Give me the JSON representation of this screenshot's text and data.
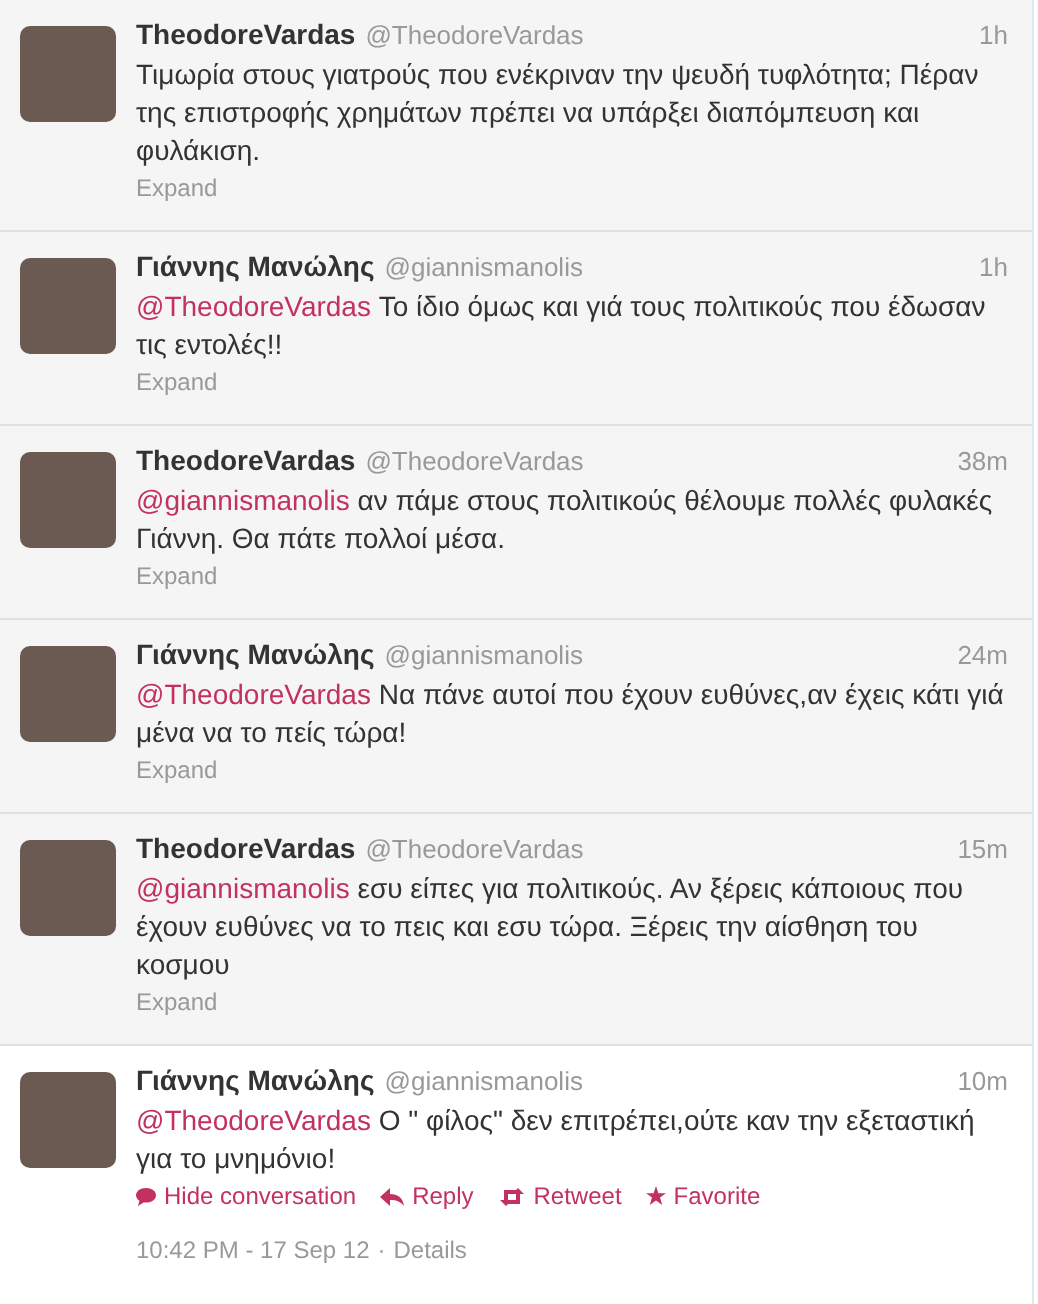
{
  "tweets": [
    {
      "name": "TheodoreVardas",
      "handle": "@TheodoreVardas",
      "time": "1h",
      "text": "Τιμωρία στους γιατρούς που ενέκριναν την ψευδή τυφλότητα; Πέραν της επιστροφής χρημάτων πρέπει να υπάρξει διαπόμπευση και φυλάκιση.",
      "expand": "Expand",
      "selected": false
    },
    {
      "name": "Γιάννης Μανώλης",
      "handle": "@giannismanolis",
      "time": "1h",
      "mention": "@TheodoreVardas",
      "text": "Το ίδιο όμως και γιά τους πολιτικούς που έδωσαν τις εντολές!!",
      "expand": "Expand",
      "selected": false
    },
    {
      "name": "TheodoreVardas",
      "handle": "@TheodoreVardas",
      "time": "38m",
      "mention": "@giannismanolis",
      "text": "αν πάμε στους πολιτικούς θέλουμε πολλές φυλακές Γιάννη. Θα πάτε πολλοί μέσα.",
      "expand": "Expand",
      "selected": false
    },
    {
      "name": "Γιάννης Μανώλης",
      "handle": "@giannismanolis",
      "time": "24m",
      "mention": "@TheodoreVardas",
      "text": "Να πάνε αυτοί που έχουν ευθύνες,αν έχεις κάτι γιά μένα να το πείς τώρα!",
      "expand": "Expand",
      "selected": false
    },
    {
      "name": "TheodoreVardas",
      "handle": "@TheodoreVardas",
      "time": "15m",
      "mention": "@giannismanolis",
      "text": "εσυ είπες για πολιτικούς. Αν ξέρεις κάποιους που έχουν ευθύνες να το πεις και εσυ τώρα. Ξέρεις την αίσθηση του κοσμου",
      "expand": "Expand",
      "selected": false
    },
    {
      "name": "Γιάννης Μανώλης",
      "handle": "@giannismanolis",
      "time": "10m",
      "mention": "@TheodoreVardas",
      "text": "Ο \" φίλος\" δεν επιτρέπει,ούτε καν την εξεταστική για το μνημόνιο!",
      "selected": true,
      "actions": [
        {
          "kind": "conversation",
          "label": "Hide conversation"
        },
        {
          "kind": "reply",
          "label": "Reply"
        },
        {
          "kind": "retweet",
          "label": "Retweet"
        },
        {
          "kind": "favorite",
          "label": "Favorite"
        }
      ],
      "timestamp": "10:42 PM - 17 Sep 12",
      "separator": "·",
      "details": "Details"
    }
  ]
}
